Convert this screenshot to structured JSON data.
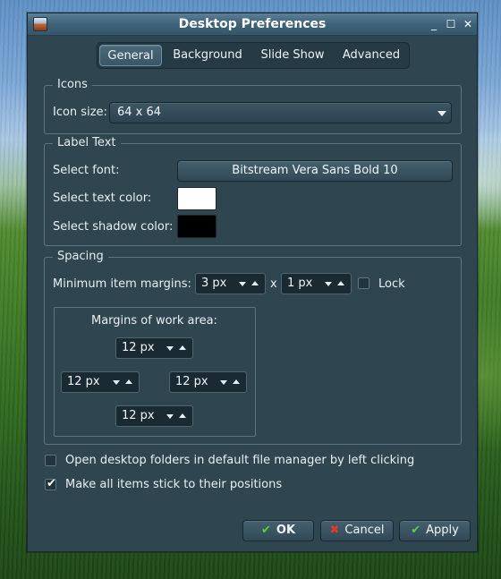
{
  "window": {
    "title": "Desktop Preferences",
    "controls": {
      "minimize": "_",
      "maximize": "☐",
      "close": "✕"
    }
  },
  "tabs": [
    {
      "label": "General",
      "active": true
    },
    {
      "label": "Background",
      "active": false
    },
    {
      "label": "Slide Show",
      "active": false
    },
    {
      "label": "Advanced",
      "active": false
    }
  ],
  "icons_section": {
    "title": "Icons",
    "icon_size_label": "Icon size:",
    "icon_size_value": "64 x 64"
  },
  "label_text_section": {
    "title": "Label Text",
    "font_label": "Select font:",
    "font_value": "Bitstream Vera Sans Bold 10",
    "text_color_label": "Select text color:",
    "text_color": "#ffffff",
    "shadow_color_label": "Select shadow color:",
    "shadow_color": "#000000"
  },
  "spacing_section": {
    "title": "Spacing",
    "min_margins_label": "Minimum item margins:",
    "margin_x": "3 px",
    "separator": "x",
    "margin_y": "1 px",
    "lock_label": "Lock",
    "lock_checked": false,
    "work_area_label": "Margins of work area:",
    "work_area_top": "12 px",
    "work_area_left": "12 px",
    "work_area_right": "12 px",
    "work_area_bottom": "12 px"
  },
  "options": {
    "open_folders_label": "Open desktop folders in default file manager by left clicking",
    "open_folders_checked": false,
    "stick_items_label": "Make all items stick to their positions",
    "stick_items_checked": true
  },
  "buttons": {
    "ok": "OK",
    "cancel": "Cancel",
    "apply": "Apply"
  },
  "colors": {
    "window_bg": "#2f4650",
    "ok_icon": "#5ad03a",
    "cancel_icon": "#e23a2a"
  },
  "icons": {
    "ok": "check-icon",
    "cancel": "x-icon",
    "apply": "check-icon",
    "checked": "checkmark"
  }
}
